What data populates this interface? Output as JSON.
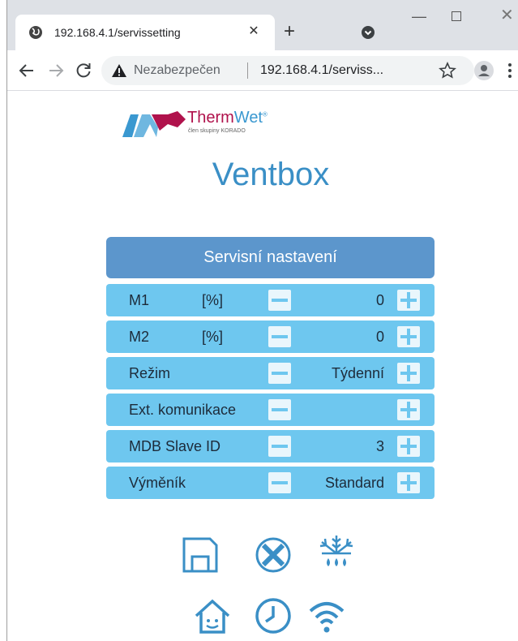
{
  "browser": {
    "tab_title": "192.168.4.1/servissetting",
    "security_label": "Nezabezpečen",
    "url": "192.168.4.1/serviss..."
  },
  "logo": {
    "brand_part1": "Therm",
    "brand_part2": "Wet",
    "registered": "®",
    "subtitle": "člen skupiny KORADO"
  },
  "app": {
    "title": "Ventbox",
    "panel_title": "Servisní nastavení"
  },
  "settings": [
    {
      "label": "M1",
      "unit": "[%]",
      "value": "0"
    },
    {
      "label": "M2",
      "unit": "[%]",
      "value": "0"
    },
    {
      "label": "Režim",
      "unit": "",
      "value": "Týdenní"
    },
    {
      "label": "Ext. komunikace",
      "unit": "",
      "value": ""
    },
    {
      "label": "MDB Slave ID",
      "unit": "",
      "value": "3"
    },
    {
      "label": "Výměník",
      "unit": "",
      "value": "Standard"
    }
  ],
  "icons": {
    "save": "floppy-save-icon",
    "cancel": "circle-x-icon",
    "defrost": "snowflake-drops-icon",
    "home": "house-smiley-icon",
    "clock": "clock-icon",
    "wifi": "wifi-icon"
  },
  "colors": {
    "accent": "#3a8fc6",
    "header": "#5c96cc",
    "row": "#6ec7ef",
    "brand_red": "#b0124c"
  }
}
